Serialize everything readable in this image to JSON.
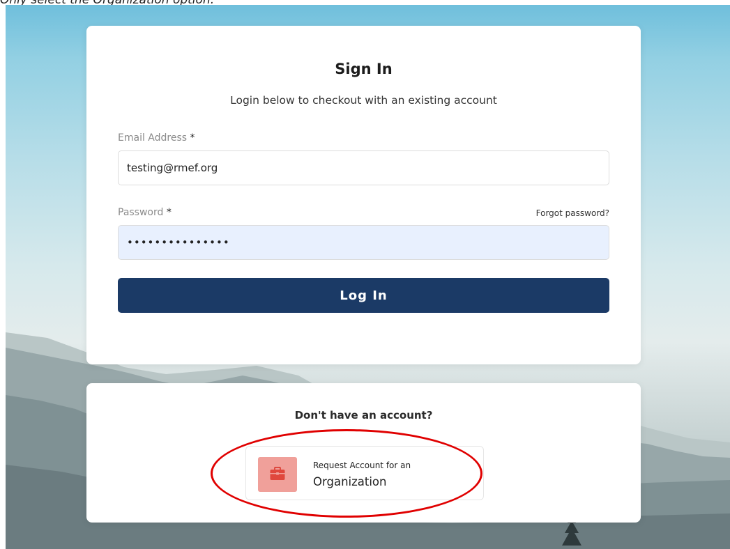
{
  "instruction": "Only select the Organization option.",
  "signin": {
    "title": "Sign In",
    "subtitle": "Login below to checkout with an existing account",
    "email_label": "Email Address",
    "required_marker": "*",
    "email_value": "testing@rmef.org",
    "password_label": "Password",
    "password_value": "•••••••••••••••",
    "forgot_link": "Forgot password?",
    "login_button": "Log In",
    "login_button_color": "#1b3a66",
    "password_field_color": "#e8f0fe"
  },
  "signup": {
    "prompt": "Don't have an account?",
    "org_button_line1": "Request Account for an",
    "org_button_line2": "Organization",
    "org_icon": "briefcase-icon",
    "org_icon_bg": "#f0a09a"
  },
  "annotation": {
    "highlight_color": "#e00000",
    "shape": "ellipse"
  }
}
